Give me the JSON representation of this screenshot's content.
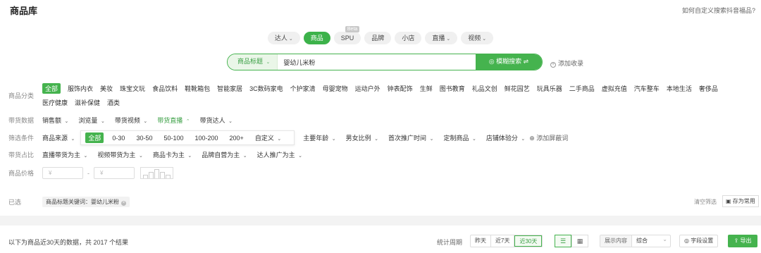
{
  "header": {
    "title": "商品库",
    "help_link": "如何自定义搜索抖音福品?"
  },
  "tabs": [
    {
      "label": "达人",
      "caret": "⌄",
      "active": false
    },
    {
      "label": "商品",
      "caret": "",
      "active": true
    },
    {
      "label": "SPU",
      "caret": "",
      "badge": "Beta",
      "active": false
    },
    {
      "label": "品牌",
      "caret": "",
      "active": false
    },
    {
      "label": "小店",
      "caret": "",
      "active": false
    },
    {
      "label": "直播",
      "caret": "⌄",
      "active": false
    },
    {
      "label": "视频",
      "caret": "⌄",
      "active": false
    }
  ],
  "search": {
    "type_label": "商品标题",
    "value": "婴幼儿米粉",
    "button_label": "◎ 模糊搜索 ⇌",
    "add_favorite": "添加收录"
  },
  "category": {
    "label": "商品分类",
    "items": [
      "全部",
      "服饰内衣",
      "美妆",
      "珠宝文玩",
      "食品饮料",
      "鞋靴箱包",
      "智能家居",
      "3C数码家电",
      "个护家清",
      "母婴宠物",
      "运动户外",
      "钟表配饰",
      "生鲜",
      "图书教育",
      "礼品文创",
      "鲜花园艺",
      "玩具乐器",
      "二手商品",
      "虚拟充值",
      "汽车整车",
      "本地生活",
      "奢侈品",
      "医疗健康",
      "滋补保健",
      "酒类"
    ]
  },
  "sales_data": {
    "label": "带货数据",
    "items": [
      {
        "text": "销售额",
        "caret": "⌄",
        "active": false
      },
      {
        "text": "浏览量",
        "caret": "⌄",
        "active": false
      },
      {
        "text": "带货视频",
        "caret": "⌄",
        "active": false
      },
      {
        "text": "带货直播",
        "caret": "⌃",
        "active": true
      },
      {
        "text": "带货达人",
        "caret": "⌄",
        "active": false
      }
    ]
  },
  "filters": {
    "label": "筛选条件",
    "source": "商品来源",
    "chips": [
      "全部",
      "0-30",
      "30-50",
      "50-100",
      "100-200",
      "200+",
      "自定义"
    ],
    "more": [
      "主要年龄",
      "男女比例",
      "首次推广时间",
      "定制商品",
      "店铺体验分"
    ],
    "add_block": "添加屏蔽词"
  },
  "share": {
    "label": "带货占比",
    "items": [
      "直播带货为主",
      "视频带货为主",
      "商品卡为主",
      "品牌自营为主",
      "达人推广为主"
    ]
  },
  "price": {
    "label": "商品价格",
    "min_placeholder": "¥",
    "max_placeholder": "¥",
    "separator": "-"
  },
  "selected": {
    "label": "已选",
    "tag": "商品标题关键词：婴幼儿米粉",
    "clear": "清空筛选",
    "save": "存为常用"
  },
  "results": {
    "summary": "以下为商品近30天的数据，共 2017 个结果",
    "period_label": "统计周期",
    "periods": [
      "昨天",
      "近7天",
      "近30天"
    ],
    "active_period": "近30天",
    "display_label": "展示内容",
    "display_value": "综合",
    "field_settings": "◎ 字段设置",
    "export": "导出"
  },
  "colors": {
    "accent": "#45b34e",
    "accent_text": "#3a9f44",
    "muted": "#888888"
  }
}
